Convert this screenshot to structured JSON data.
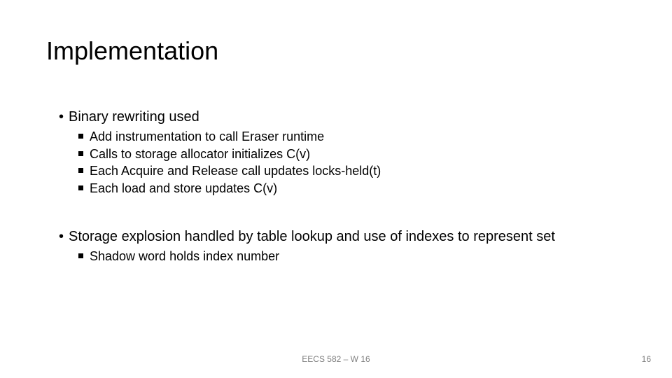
{
  "title": "Implementation",
  "bullets": [
    {
      "text": "Binary rewriting used",
      "sub": [
        "Add instrumentation to call Eraser runtime",
        "Calls to storage allocator initializes C(v)",
        "Each Acquire and Release call updates locks-held(t)",
        "Each load and store updates C(v)"
      ]
    },
    {
      "text": "Storage explosion handled by table lookup and use of indexes to represent set",
      "sub": [
        "Shadow word holds index number"
      ]
    }
  ],
  "footer": {
    "center": "EECS 582 – W 16",
    "right": "16"
  }
}
